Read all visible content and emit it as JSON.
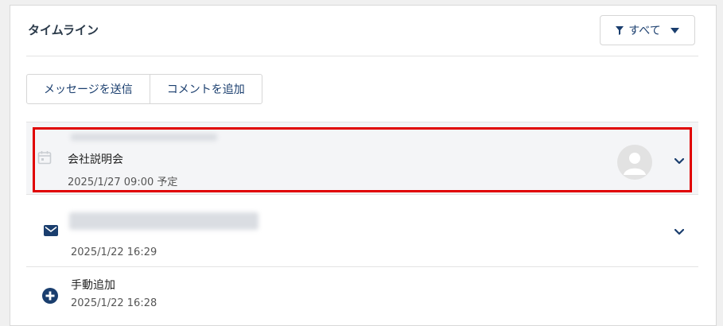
{
  "timeline": {
    "title": "タイムライン",
    "filter": {
      "label": "すべて",
      "icon": "filter-icon",
      "dropdown_icon": "caret-down-icon"
    }
  },
  "actions": {
    "send_message": "メッセージを送信",
    "add_comment": "コメントを追加"
  },
  "items": [
    {
      "icon": "calendar-icon",
      "title": "会社説明会",
      "timestamp": "2025/1/27 09:00 予定",
      "has_avatar": true,
      "expand_icon": "chevron-down-icon",
      "highlighted": true
    },
    {
      "icon": "envelope-icon",
      "timestamp": "2025/1/22 16:29",
      "expand_icon": "chevron-down-icon"
    },
    {
      "icon": "plus-circle-icon",
      "title": "手動追加",
      "timestamp": "2025/1/22 16:28"
    }
  ],
  "colors": {
    "accent": "#1a3e6e",
    "highlight_border": "#e00000",
    "selected_row_bg": "#f4f5f7"
  }
}
